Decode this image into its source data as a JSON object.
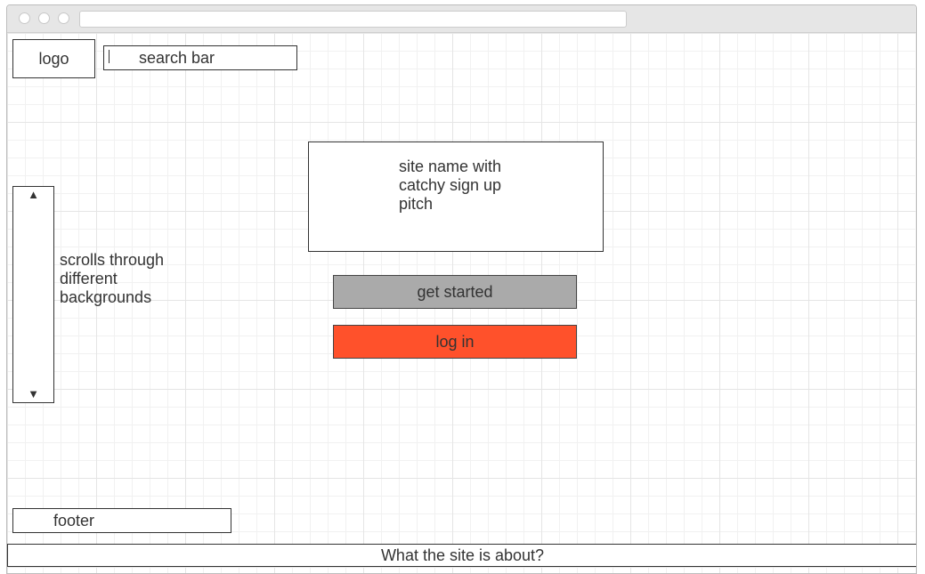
{
  "logo": {
    "label": "logo"
  },
  "search": {
    "placeholder": "search bar"
  },
  "scroller": {
    "up_arrow": "▲",
    "down_arrow": "▼",
    "note": "scrolls through different backgrounds"
  },
  "hero": {
    "pitch": "site name with catchy sign up pitch"
  },
  "buttons": {
    "get_started": "get started",
    "log_in": "log in"
  },
  "colors": {
    "get_started_bg": "#aaaaaa",
    "log_in_bg": "#ff512b"
  },
  "footer": {
    "label": "footer"
  },
  "about": {
    "label": "What the site is about?"
  }
}
